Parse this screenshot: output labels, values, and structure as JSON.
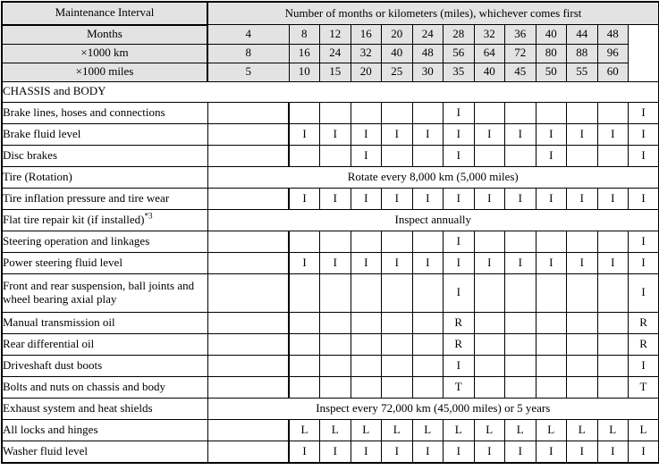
{
  "table": {
    "corner_title": "Maintenance Interval",
    "interval_header": "Number of months or kilometers (miles), whichever comes first",
    "unit_rows": [
      {
        "label": "Months",
        "values": [
          "4",
          "8",
          "12",
          "16",
          "20",
          "24",
          "28",
          "32",
          "36",
          "40",
          "44",
          "48"
        ]
      },
      {
        "label": "×1000 km",
        "values": [
          "8",
          "16",
          "24",
          "32",
          "40",
          "48",
          "56",
          "64",
          "72",
          "80",
          "88",
          "96"
        ]
      },
      {
        "label": "×1000 miles",
        "values": [
          "5",
          "10",
          "15",
          "20",
          "25",
          "30",
          "35",
          "40",
          "45",
          "50",
          "55",
          "60"
        ]
      }
    ],
    "section_title": "CHASSIS and BODY",
    "rows": [
      {
        "label": "Brake lines, hoses and connections",
        "footnote": "",
        "tall": false,
        "span": null,
        "cells": [
          "",
          "",
          "",
          "",
          "",
          "I",
          "",
          "",
          "",
          "",
          "",
          "I"
        ]
      },
      {
        "label": "Brake fluid level",
        "footnote": "",
        "tall": false,
        "span": null,
        "cells": [
          "I",
          "I",
          "I",
          "I",
          "I",
          "I",
          "I",
          "I",
          "I",
          "I",
          "I",
          "I"
        ]
      },
      {
        "label": "Disc brakes",
        "footnote": "",
        "tall": false,
        "span": null,
        "cells": [
          "",
          "",
          "I",
          "",
          "",
          "I",
          "",
          "",
          "I",
          "",
          "",
          "I"
        ]
      },
      {
        "label": "Tire (Rotation)",
        "footnote": "",
        "tall": false,
        "span": "Rotate every 8,000 km (5,000 miles)",
        "cells": []
      },
      {
        "label": "Tire inflation pressure and tire wear",
        "footnote": "",
        "tall": false,
        "span": null,
        "cells": [
          "I",
          "I",
          "I",
          "I",
          "I",
          "I",
          "I",
          "I",
          "I",
          "I",
          "I",
          "I"
        ]
      },
      {
        "label": "Flat tire repair kit (if installed)",
        "footnote": "*3",
        "tall": false,
        "span": "Inspect annually",
        "cells": []
      },
      {
        "label": "Steering operation and linkages",
        "footnote": "",
        "tall": false,
        "span": null,
        "cells": [
          "",
          "",
          "",
          "",
          "",
          "I",
          "",
          "",
          "",
          "",
          "",
          "I"
        ]
      },
      {
        "label": "Power steering fluid level",
        "footnote": "",
        "tall": false,
        "span": null,
        "cells": [
          "I",
          "I",
          "I",
          "I",
          "I",
          "I",
          "I",
          "I",
          "I",
          "I",
          "I",
          "I"
        ]
      },
      {
        "label": "Front and rear suspension, ball joints and wheel bearing axial play",
        "footnote": "",
        "tall": true,
        "span": null,
        "cells": [
          "",
          "",
          "",
          "",
          "",
          "I",
          "",
          "",
          "",
          "",
          "",
          "I"
        ]
      },
      {
        "label": "Manual transmission oil",
        "footnote": "",
        "tall": false,
        "span": null,
        "cells": [
          "",
          "",
          "",
          "",
          "",
          "R",
          "",
          "",
          "",
          "",
          "",
          "R"
        ]
      },
      {
        "label": "Rear differential oil",
        "footnote": "",
        "tall": false,
        "span": null,
        "cells": [
          "",
          "",
          "",
          "",
          "",
          "R",
          "",
          "",
          "",
          "",
          "",
          "R"
        ]
      },
      {
        "label": "Driveshaft dust boots",
        "footnote": "",
        "tall": false,
        "span": null,
        "cells": [
          "",
          "",
          "",
          "",
          "",
          "I",
          "",
          "",
          "",
          "",
          "",
          "I"
        ]
      },
      {
        "label": "Bolts and nuts on chassis and body",
        "footnote": "",
        "tall": false,
        "span": null,
        "cells": [
          "",
          "",
          "",
          "",
          "",
          "T",
          "",
          "",
          "",
          "",
          "",
          "T"
        ]
      },
      {
        "label": "Exhaust system and heat shields",
        "footnote": "",
        "tall": false,
        "span": "Inspect every 72,000 km (45,000 miles) or 5 years",
        "cells": []
      },
      {
        "label": "All locks and hinges",
        "footnote": "",
        "tall": false,
        "span": null,
        "cells": [
          "L",
          "L",
          "L",
          "L",
          "L",
          "L",
          "L",
          "L",
          "L",
          "L",
          "L",
          "L"
        ]
      },
      {
        "label": "Washer fluid level",
        "footnote": "",
        "tall": false,
        "span": null,
        "cells": [
          "I",
          "I",
          "I",
          "I",
          "I",
          "I",
          "I",
          "I",
          "I",
          "I",
          "I",
          "I"
        ]
      }
    ]
  },
  "colors": {
    "header_background": "#e3e3e3",
    "border": "#000000",
    "text": "#000000",
    "page_background": "#ffffff"
  }
}
